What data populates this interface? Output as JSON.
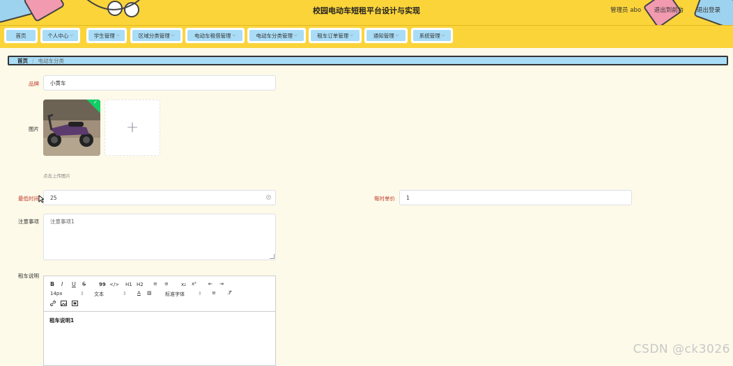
{
  "header": {
    "title": "校园电动车短租平台设计与实现",
    "user_label": "管理员 abo",
    "front_link": "退出到前台",
    "logout_link": "退出登录"
  },
  "nav": {
    "items": [
      {
        "label": "首页",
        "has_caret": false
      },
      {
        "label": "个人中心",
        "has_caret": true
      },
      {
        "label": "学生管理",
        "has_caret": true
      },
      {
        "label": "区域分类管理",
        "has_caret": true
      },
      {
        "label": "电动车租借管理",
        "has_caret": true
      },
      {
        "label": "电动车分类管理",
        "has_caret": true
      },
      {
        "label": "租车订单管理",
        "has_caret": true
      },
      {
        "label": "通知管理",
        "has_caret": true
      },
      {
        "label": "系统管理",
        "has_caret": true
      }
    ]
  },
  "breadcrumb": {
    "home": "首页",
    "separator": "/",
    "current": "电动车分类"
  },
  "form": {
    "brand": {
      "label": "品牌",
      "value": "小黄车"
    },
    "image": {
      "label": "图片",
      "hint": "点击上传图片",
      "add_symbol": "+",
      "check": "✓"
    },
    "min_time": {
      "label": "最低时间",
      "value": "25",
      "clear_icon": "ⓧ"
    },
    "hourly_price": {
      "label": "每时单价",
      "value": "1"
    },
    "notes": {
      "label": "注意事项",
      "value": "注意事项1"
    },
    "rental_desc": {
      "label": "租车说明",
      "toolbar": {
        "bold": "B",
        "italic": "I",
        "underline": "U",
        "strike": "S",
        "quote": "99",
        "code": "</>",
        "h1": "H1",
        "h2": "H2",
        "ordered_list": "≡",
        "bullet_list": "≡",
        "subscript": "x₂",
        "superscript": "x²",
        "indent_left": "⇤",
        "indent_right": "⇥",
        "font_size": "14px",
        "text_type": "文本",
        "font_family": "标准字体",
        "select_caret": "⇕"
      },
      "content": "租车说明1"
    }
  },
  "watermark": "CSDN @ck3026",
  "colors": {
    "header_bg": "#fbd43a",
    "nav_item_bg": "#a9dcf6",
    "page_bg": "#fdfae9",
    "required_label": "#c0392b",
    "upload_success": "#13ce66"
  }
}
